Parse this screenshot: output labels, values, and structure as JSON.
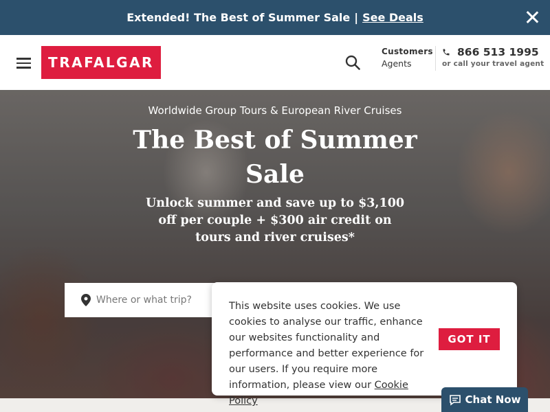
{
  "promo": {
    "text": "Extended! The Best of Summer Sale",
    "separator": "|",
    "link": "See Deals"
  },
  "header": {
    "logo": "TRAFALGAR",
    "customers_label": "Customers",
    "agents_label": "Agents",
    "phone": "866 513 1995",
    "phone_sub": "or call your travel agent"
  },
  "hero": {
    "kicker": "Worldwide Group Tours & European River Cruises",
    "title": "The Best of Summer Sale",
    "subtitle": "Unlock summer and save up to $3,100 off per couple + $300 air credit on tours and river cruises*",
    "search_placeholder": "Where or what trip?"
  },
  "cookie": {
    "text": "This website uses cookies. We use cookies to analyse our traffic, enhance our websites functionality and performance and better experience for our users. If you require more information, please view our",
    "link": "Cookie Policy",
    "button": "GOT IT"
  },
  "chat": {
    "label": "Chat Now"
  },
  "colors": {
    "brand_red": "#de1d3f",
    "banner_blue": "#2c506c"
  }
}
